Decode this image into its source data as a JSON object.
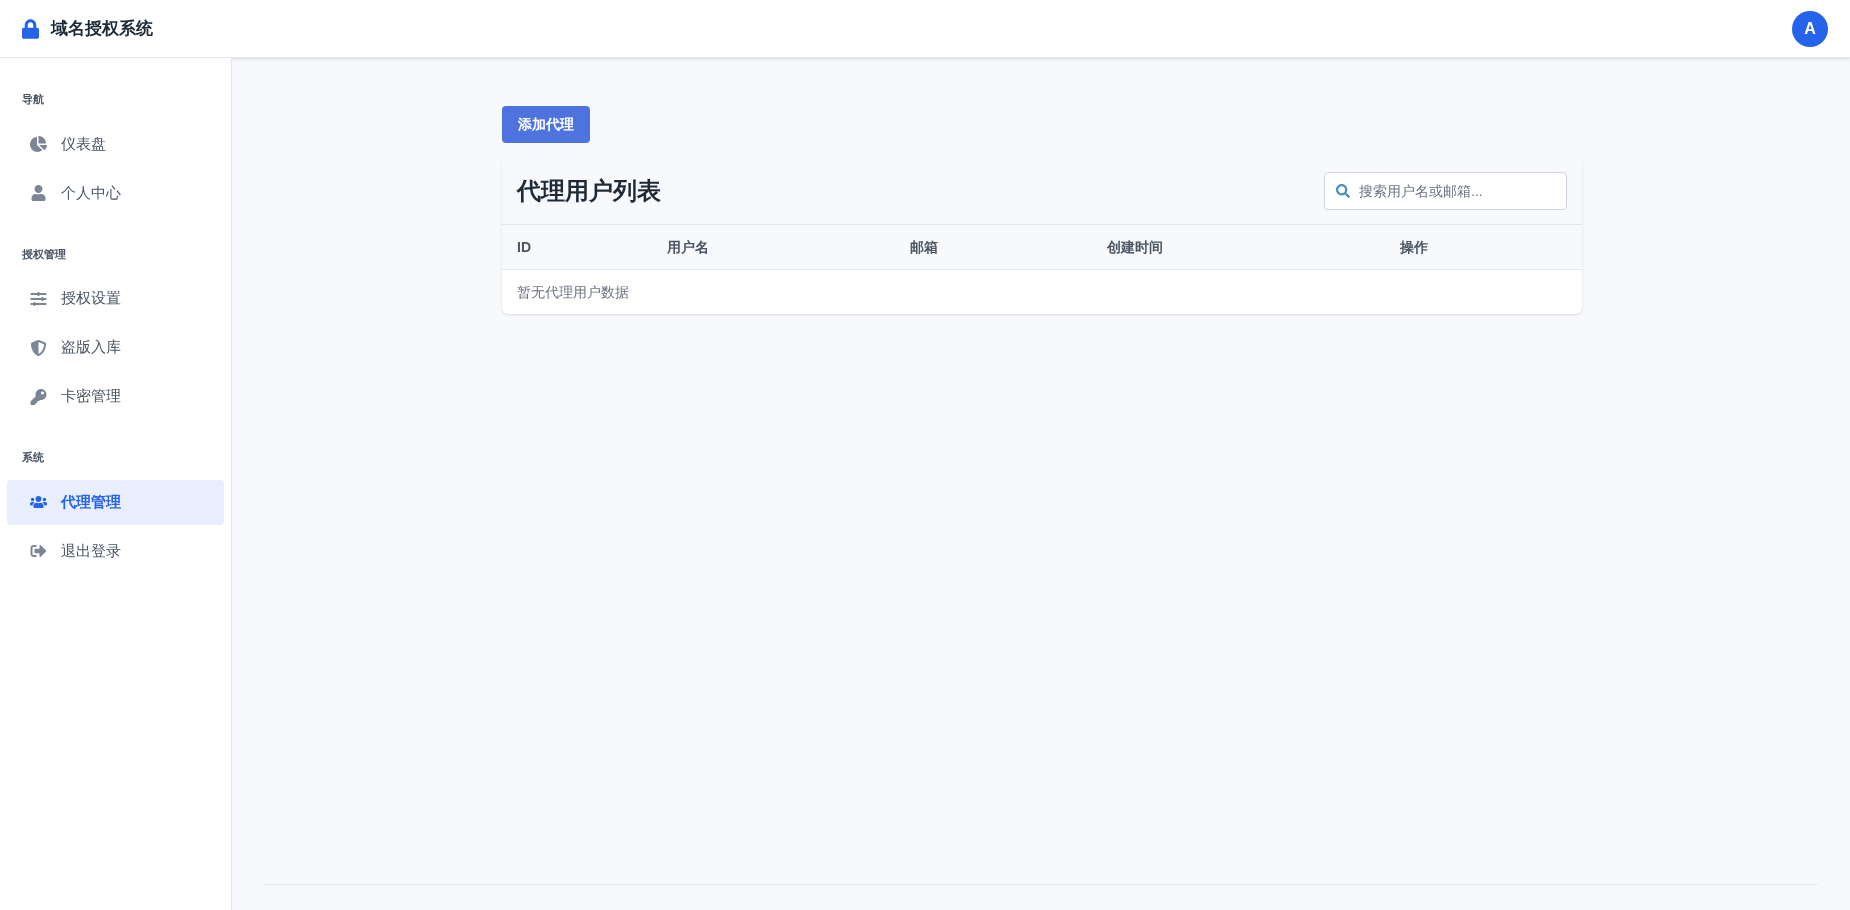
{
  "header": {
    "title": "域名授权系统",
    "avatar": "A"
  },
  "sidebar": {
    "sections": [
      {
        "heading": "导航",
        "items": [
          {
            "label": "仪表盘",
            "selected": false
          },
          {
            "label": "个人中心",
            "selected": false
          }
        ]
      },
      {
        "heading": "授权管理",
        "items": [
          {
            "label": "授权设置",
            "selected": false
          },
          {
            "label": "盗版入库",
            "selected": false
          },
          {
            "label": "卡密管理",
            "selected": false
          }
        ]
      },
      {
        "heading": "系统",
        "items": [
          {
            "label": "代理管理",
            "selected": true
          },
          {
            "label": "退出登录",
            "selected": false
          }
        ]
      }
    ]
  },
  "add_button": "添加代理",
  "table": {
    "title": "代理用户列表",
    "search": {
      "placeholder": "搜索用户名或邮箱..."
    },
    "columns": [
      "ID",
      "用户名",
      "邮箱",
      "创建时间",
      "操作"
    ],
    "empty_message": "暂无代理用户数据"
  }
}
